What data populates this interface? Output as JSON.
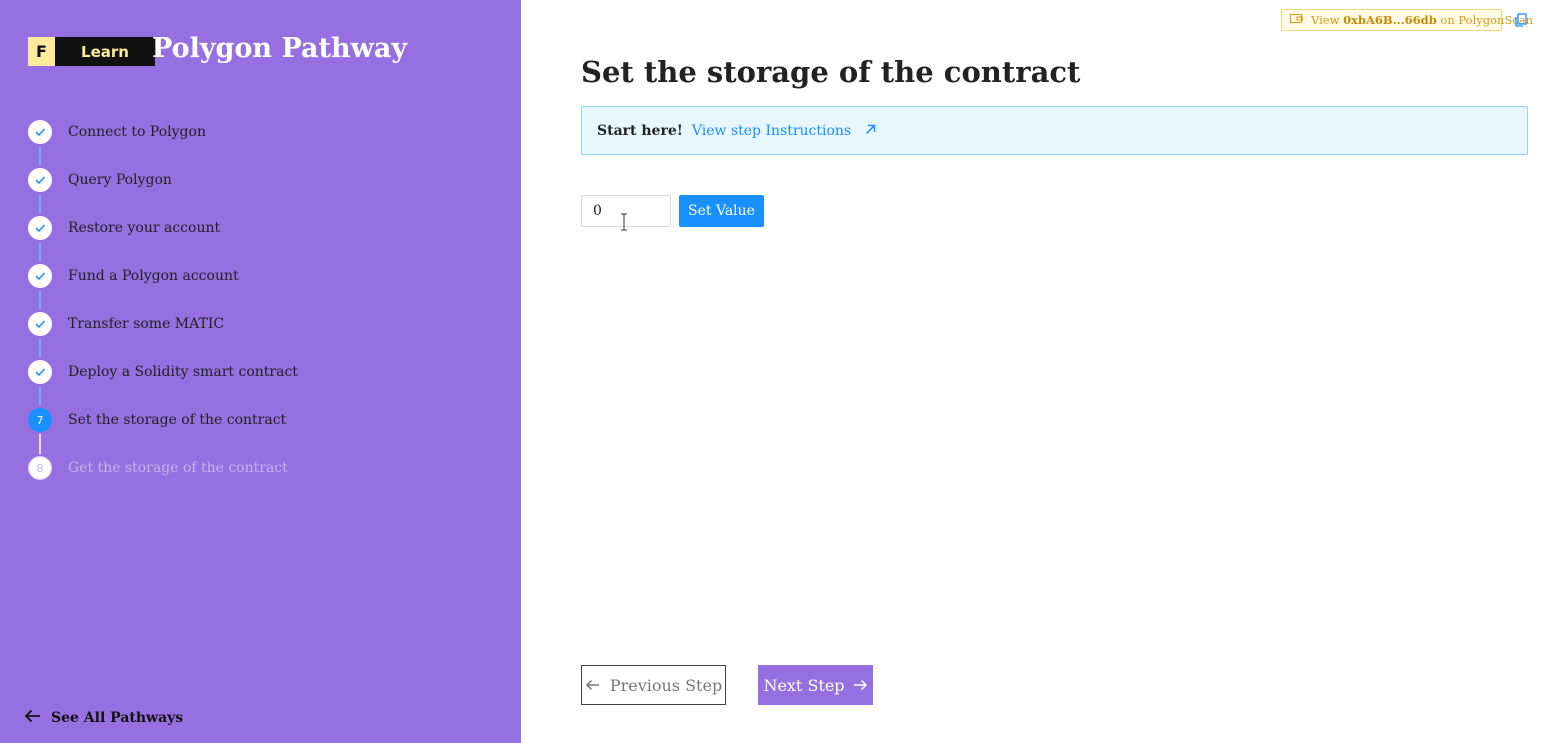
{
  "logo": {
    "f": "F",
    "learn": "Learn"
  },
  "pathway": {
    "title": "Polygon Pathway"
  },
  "steps": [
    {
      "number": "1",
      "label": "Connect to Polygon",
      "status": "done"
    },
    {
      "number": "2",
      "label": "Query Polygon",
      "status": "done"
    },
    {
      "number": "3",
      "label": "Restore your account",
      "status": "done"
    },
    {
      "number": "4",
      "label": "Fund a Polygon account",
      "status": "done"
    },
    {
      "number": "5",
      "label": "Transfer some MATIC",
      "status": "done"
    },
    {
      "number": "6",
      "label": "Deploy a Solidity smart contract",
      "status": "done"
    },
    {
      "number": "7",
      "label": "Set the storage of the contract",
      "status": "current"
    },
    {
      "number": "8",
      "label": "Get the storage of the contract",
      "status": "pending"
    }
  ],
  "see_all": "See All Pathways",
  "explorer": {
    "view": "View",
    "address": "0xbA6B...66db",
    "suffix": "on PolygonScan"
  },
  "main": {
    "title": "Set the storage of the contract",
    "banner_start": "Start here!",
    "banner_link": "View step Instructions",
    "input_value": "0",
    "set_button": "Set Value"
  },
  "nav": {
    "previous": "Previous Step",
    "next": "Next Step"
  },
  "colors": {
    "sidebar": "#9670e1",
    "accent": "#1890ff",
    "banner_bg": "#e6f7ff",
    "logo_yellow": "#fdeb9c"
  },
  "icons": {
    "check": "check-icon",
    "arrow_left": "arrow-left-icon",
    "arrow_right": "arrow-right-icon",
    "external": "external-link-icon",
    "copy": "copy-icon",
    "wallet": "wallet-icon"
  }
}
